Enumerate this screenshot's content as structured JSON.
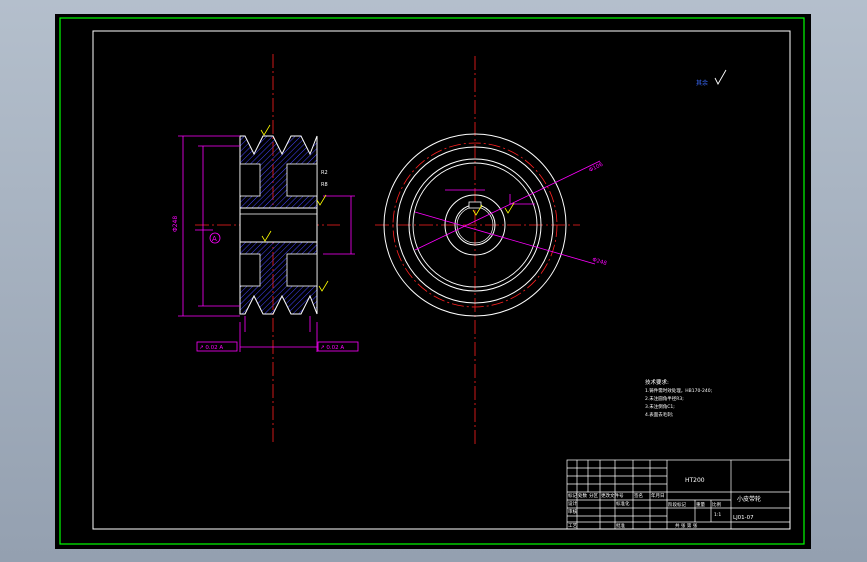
{
  "drawing": {
    "material": "HT200",
    "part_name": "小皮带轮",
    "drawing_number": "LJ01-07",
    "datum_label": "A",
    "tech_notes": {
      "title": "技术要求:",
      "items": [
        "1.铸件需时效处理，HB170-240;",
        "2.未注圆角半径R3;",
        "3.未注倒角C1;",
        "4.表面去毛刺;"
      ]
    },
    "title_block": {
      "row_labels": [
        "标记",
        "处数",
        "分区",
        "更改文件号",
        "签名",
        "年月日"
      ],
      "designer": "设计",
      "standardize": "标准化",
      "reviewer": "审核",
      "process": "工艺",
      "approve": "批准",
      "stage_mark": "阶段标记",
      "weight": "重量",
      "scale": "比例",
      "scale_value": "1:1",
      "sheet_info": "共 张 第 张"
    },
    "tolerance_frames": [
      "↗ 0.02 A",
      "↗ 0.02 A"
    ],
    "dimensions": [
      "Φ248",
      "Φ106",
      "R2",
      "R8"
    ],
    "colors": {
      "frame": "#00ff00",
      "paper": "#000000",
      "dimension": "#ff00ff",
      "centerline": "#ff2020",
      "outline": "#ffffff",
      "hatch": "#4444ff",
      "text": "#ffffff"
    }
  }
}
